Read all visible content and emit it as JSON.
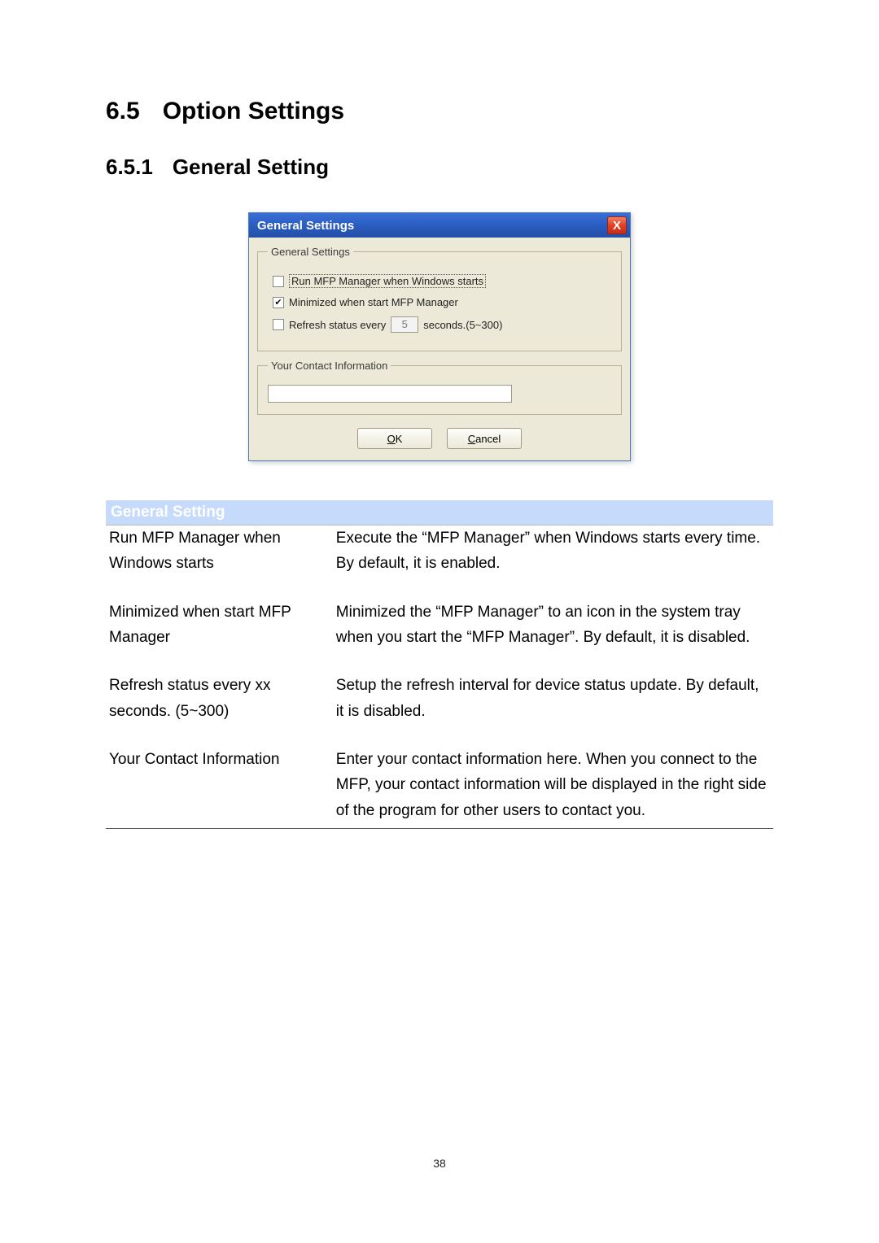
{
  "headings": {
    "section_num": "6.5",
    "section_title": "Option Settings",
    "subsection_num": "6.5.1",
    "subsection_title": "General Setting"
  },
  "dialog": {
    "title": "General Settings",
    "close_icon": "X",
    "groupbox1": "General Settings",
    "opt1": "Run MFP Manager when Windows starts",
    "opt1_checked": false,
    "opt2": "Minimized when start MFP Manager",
    "opt2_checked": true,
    "opt3_prefix": "Refresh status every",
    "opt3_value": "5",
    "opt3_suffix": "seconds.(5~300)",
    "opt3_checked": false,
    "groupbox2": "Your Contact Information",
    "contact_value": "",
    "ok_label_ul": "O",
    "ok_label_rest": "K",
    "cancel_label_ul": "C",
    "cancel_label_rest": "ancel"
  },
  "table": {
    "header": "General Setting",
    "rows": [
      {
        "left": "Run MFP Manager when Windows starts",
        "right": "Execute the “MFP Manager” when Windows starts every time. By default, it is enabled."
      },
      {
        "left": "Minimized when start MFP Manager",
        "right": "Minimized the “MFP Manager” to an icon in the system tray when you start the “MFP Manager”. By default, it is disabled."
      },
      {
        "left": "Refresh status every xx seconds. (5~300)",
        "right": "Setup the refresh interval for device status update. By default, it is disabled."
      },
      {
        "left": "Your Contact Information",
        "right": "Enter your contact information here. When you connect to the MFP, your contact information will be displayed in the right side of the program for other users to contact you."
      }
    ]
  },
  "page_number": "38"
}
